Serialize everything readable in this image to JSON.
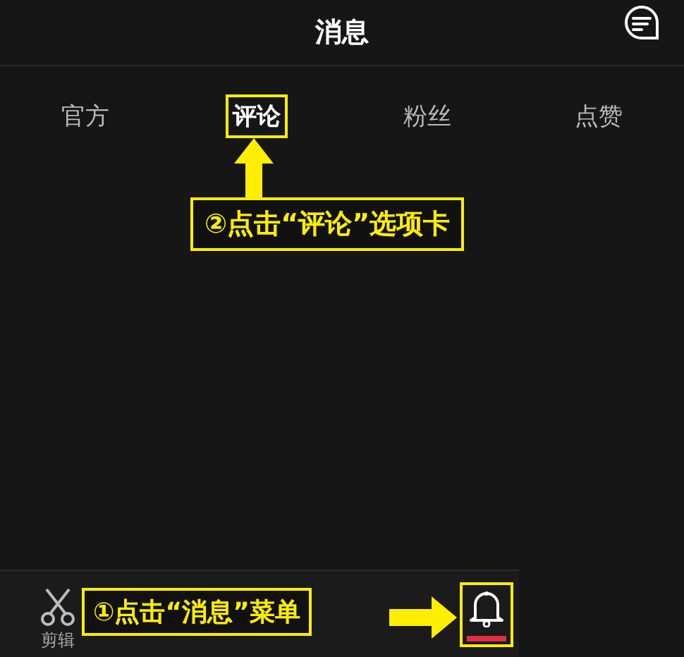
{
  "header": {
    "title": "消息"
  },
  "tabs": [
    {
      "label": "官方",
      "selected": false
    },
    {
      "label": "评论",
      "selected": true
    },
    {
      "label": "粉丝",
      "selected": false
    },
    {
      "label": "点赞",
      "selected": false
    }
  ],
  "callouts": [
    {
      "kind": "tab-hint",
      "text": "②点击“评论”选项卡"
    },
    {
      "kind": "menu-hint",
      "text": "①点击“消息”菜单"
    }
  ],
  "bottom_nav": [
    {
      "kind": "edit",
      "label": "剪辑",
      "selected": false
    },
    {
      "kind": "messages",
      "selected": true
    }
  ]
}
